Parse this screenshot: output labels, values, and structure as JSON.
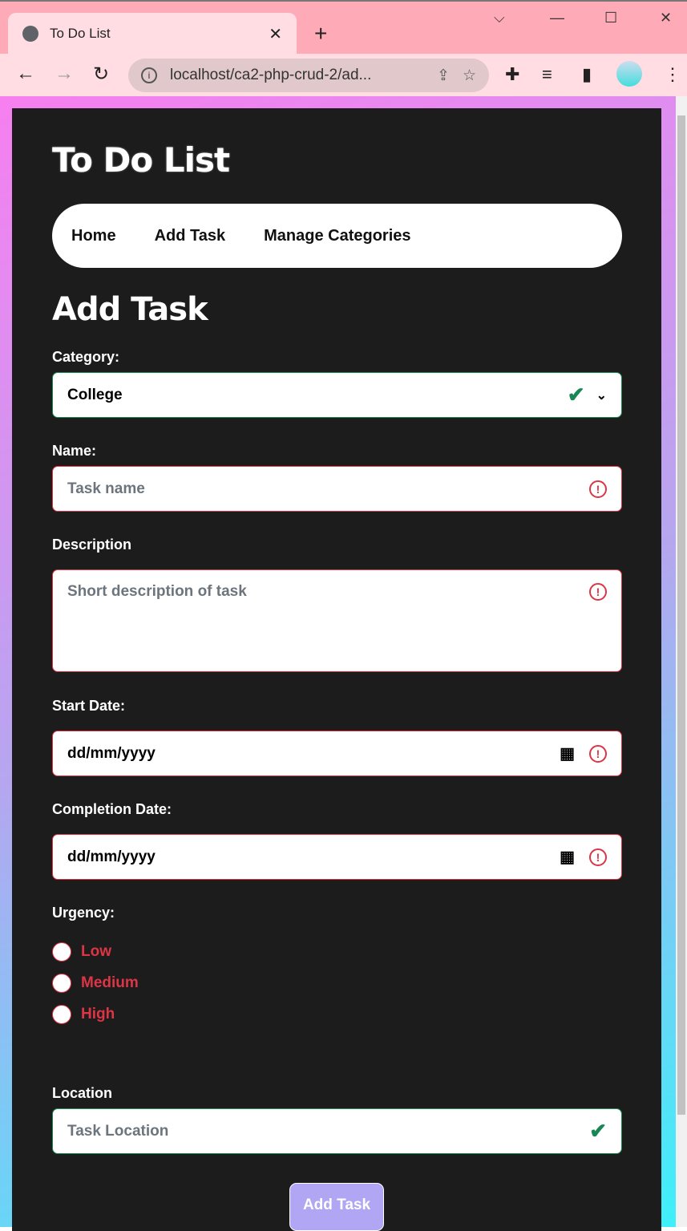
{
  "browser": {
    "tab_title": "To Do List",
    "url": "localhost/ca2-php-crud-2/ad..."
  },
  "header": {
    "title": "To Do List"
  },
  "nav": [
    "Home",
    "Add Task",
    "Manage Categories"
  ],
  "form": {
    "title": "Add Task",
    "category_label": "Category:",
    "category_value": "College",
    "name_label": "Name:",
    "name_placeholder": "Task name",
    "description_label": "Description",
    "description_placeholder": "Short description of task",
    "start_label": "Start Date:",
    "start_placeholder": "dd/mm/yyyy",
    "completion_label": "Completion Date:",
    "completion_placeholder": "dd/mm/yyyy",
    "urgency_label": "Urgency:",
    "urgency_options": [
      "Low",
      "Medium",
      "High"
    ],
    "location_label": "Location",
    "location_placeholder": "Task Location",
    "submit": "Add Task"
  },
  "colors": {
    "valid": "#198754",
    "invalid": "#dc3545",
    "button": "#b0a6f4"
  }
}
